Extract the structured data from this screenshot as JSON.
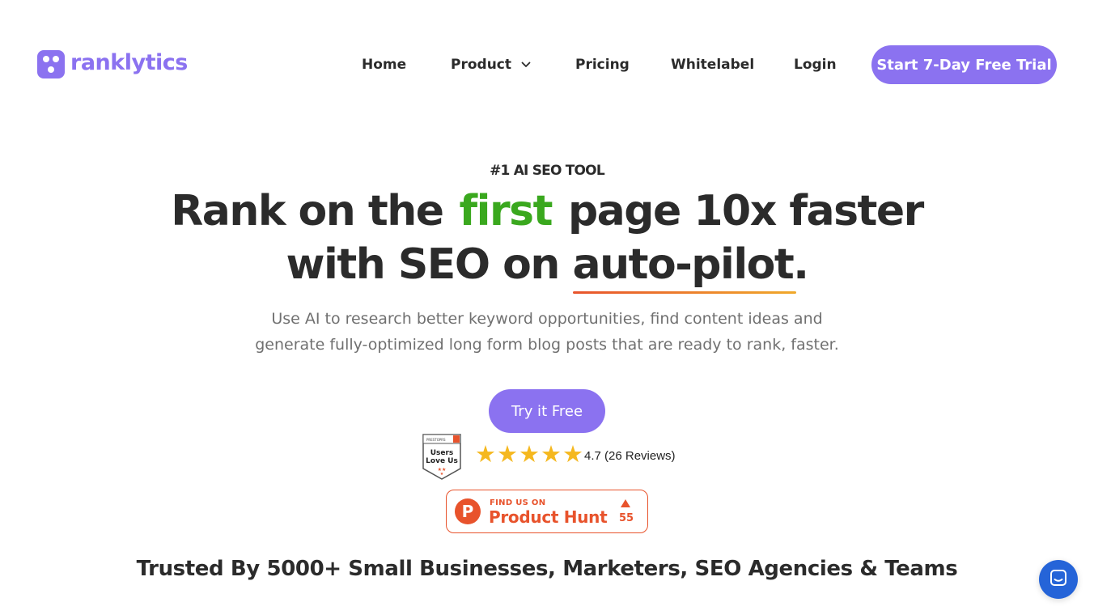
{
  "brand": {
    "name": "ranklytics",
    "accent_color": "#8b72f0"
  },
  "nav": {
    "items": [
      {
        "label": "Home"
      },
      {
        "label": "Product",
        "has_dropdown": true
      },
      {
        "label": "Pricing"
      },
      {
        "label": "Whitelabel"
      },
      {
        "label": "Login"
      }
    ],
    "cta_label": "Start 7-Day Free Trial"
  },
  "hero": {
    "eyebrow": "#1 AI SEO TOOL",
    "headline_part1": "Rank on the",
    "headline_highlight": "first",
    "headline_part2": "page 10x faster",
    "headline_line2_prefix": "with SEO on ",
    "headline_underlined": "auto-pilot.",
    "highlight_color": "#3aa81e",
    "subtitle_line1": "Use AI to research better keyword opportunities, find content ideas and",
    "subtitle_line2": "generate fully-optimized long form blog posts that are ready to rank, faster.",
    "cta_label": "Try it Free"
  },
  "reviews": {
    "badge_top": "PRESTOPRS",
    "badge_line1": "Users",
    "badge_line2": "Love Us",
    "stars": 5,
    "rating_text": "4.7 (26 Reviews)",
    "star_color": "#f5b81f"
  },
  "product_hunt": {
    "logo_letter": "P",
    "small_label": "FIND US ON",
    "big_label": "Product Hunt",
    "upvotes": "55",
    "color": "#e8532c"
  },
  "trusted_text": "Trusted By 5000+ Small Businesses, Marketers, SEO Agencies & Teams",
  "chat": {
    "icon": "chat-icon",
    "color": "#2564d8"
  }
}
